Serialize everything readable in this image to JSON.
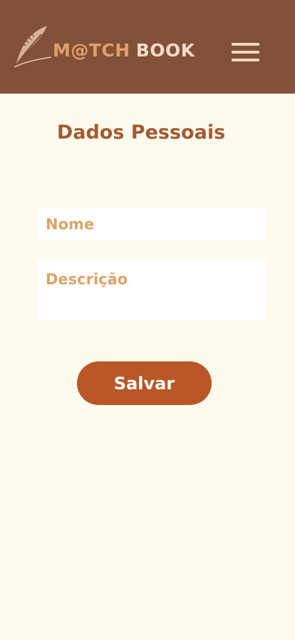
{
  "header": {
    "logo": {
      "icon": "feather-quill-icon",
      "brand_part1": "M@TCH",
      "brand_part2": "BOOK"
    },
    "menu_icon": "hamburger-menu-icon"
  },
  "page": {
    "title": "Dados Pessoais"
  },
  "form": {
    "name_placeholder": "Nome",
    "name_value": "",
    "description_placeholder": "Descrição",
    "description_value": "",
    "save_label": "Salvar"
  },
  "colors": {
    "header_bg": "#83503a",
    "page_bg": "#fdfbee",
    "title": "#a35b33",
    "placeholder": "#dca36a",
    "button_bg": "#b95726",
    "logo_accent": "#e0a066",
    "logo_light": "#f2dcc4"
  }
}
